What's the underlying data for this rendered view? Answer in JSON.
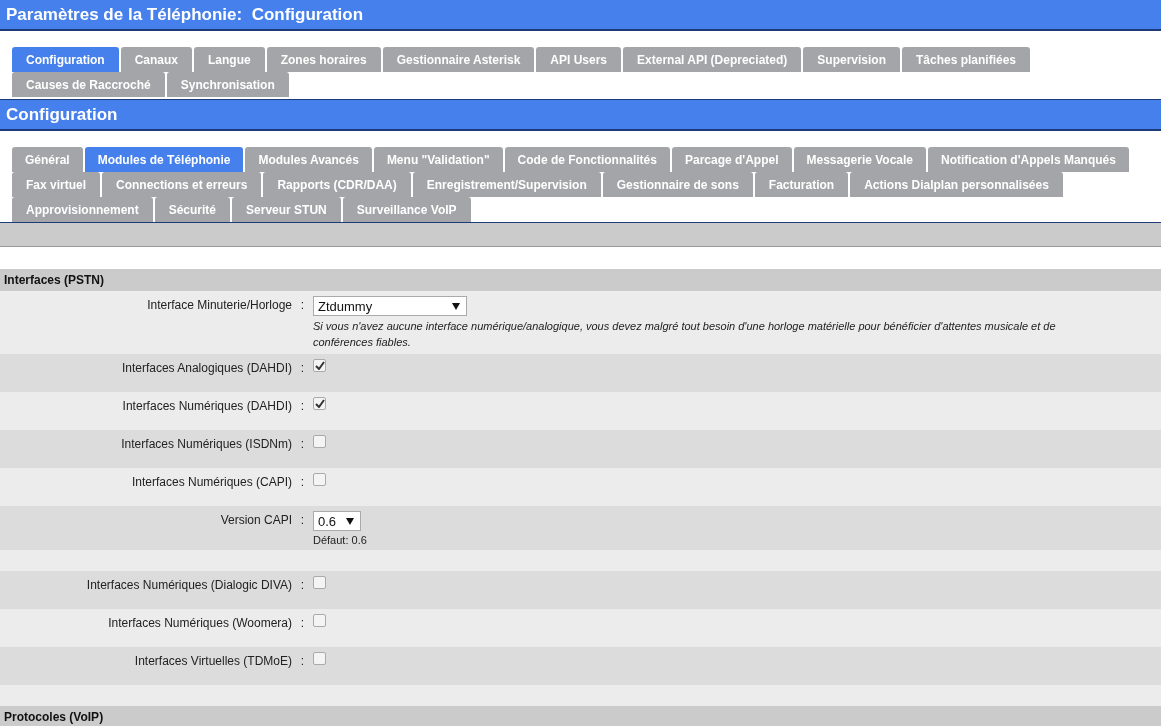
{
  "page_title": {
    "label": "Paramètres de la Téléphonie:",
    "value": "Configuration"
  },
  "main_tab_rows": [
    [
      {
        "label": "Configuration",
        "selected": true
      },
      {
        "label": "Canaux",
        "selected": false
      },
      {
        "label": "Langue",
        "selected": false
      },
      {
        "label": "Zones horaires",
        "selected": false
      },
      {
        "label": "Gestionnaire Asterisk",
        "selected": false
      },
      {
        "label": "API Users",
        "selected": false
      },
      {
        "label": "External API (Depreciated)",
        "selected": false
      },
      {
        "label": "Supervision",
        "selected": false
      },
      {
        "label": "Tâches planifiées",
        "selected": false
      }
    ],
    [
      {
        "label": "Causes de Raccroché",
        "selected": false
      },
      {
        "label": "Synchronisation",
        "selected": false
      }
    ]
  ],
  "section_title": "Configuration",
  "sub_tab_rows": [
    [
      {
        "label": "Général",
        "selected": false
      },
      {
        "label": "Modules de Téléphonie",
        "selected": true
      },
      {
        "label": "Modules Avancés",
        "selected": false
      },
      {
        "label": "Menu \"Validation\"",
        "selected": false
      },
      {
        "label": "Code de Fonctionnalités",
        "selected": false
      },
      {
        "label": "Parcage d'Appel",
        "selected": false
      },
      {
        "label": "Messagerie Vocale",
        "selected": false
      },
      {
        "label": "Notification d'Appels Manqués",
        "selected": false
      }
    ],
    [
      {
        "label": "Fax virtuel",
        "selected": false
      },
      {
        "label": "Connections et erreurs",
        "selected": false
      },
      {
        "label": "Rapports (CDR/DAA)",
        "selected": false
      },
      {
        "label": "Enregistrement/Supervision",
        "selected": false
      },
      {
        "label": "Gestionnaire de sons",
        "selected": false
      },
      {
        "label": "Facturation",
        "selected": false
      },
      {
        "label": "Actions Dialplan personnalisées",
        "selected": false
      }
    ],
    [
      {
        "label": "Approvisionnement",
        "selected": false
      },
      {
        "label": "Sécurité",
        "selected": false
      },
      {
        "label": "Serveur STUN",
        "selected": false
      },
      {
        "label": "Surveillance VoIP",
        "selected": false
      }
    ]
  ],
  "form_rows": [
    {
      "kind": "heading",
      "label": "Interfaces (PSTN)"
    },
    {
      "kind": "select",
      "label": "Interface Minuterie/Horloge",
      "separator": ":",
      "value": "Ztdummy",
      "wide": true,
      "help": "Si vous n'avez aucune interface numérique/analogique, vous devez malgré tout besoin d'une horloge matérielle pour bénéficier d'attentes musicale et de conférences fiables."
    },
    {
      "kind": "checkbox",
      "label": "Interfaces Analogiques (DAHDI)",
      "separator": ":",
      "checked": true
    },
    {
      "kind": "checkbox",
      "label": "Interfaces Numériques (DAHDI)",
      "separator": ":",
      "checked": true
    },
    {
      "kind": "checkbox",
      "label": "Interfaces Numériques (ISDNm)",
      "separator": ":",
      "checked": false
    },
    {
      "kind": "checkbox",
      "label": "Interfaces Numériques (CAPI)",
      "separator": ":",
      "checked": false
    },
    {
      "kind": "select",
      "label": "Version CAPI",
      "separator": ":",
      "value": "0.6",
      "wide": false,
      "default": "Défaut: 0.6"
    },
    {
      "kind": "spacer"
    },
    {
      "kind": "checkbox",
      "label": "Interfaces Numériques (Dialogic DIVA)",
      "separator": ":",
      "checked": false
    },
    {
      "kind": "checkbox",
      "label": "Interfaces Numériques (Woomera)",
      "separator": ":",
      "checked": false
    },
    {
      "kind": "checkbox",
      "label": "Interfaces Virtuelles (TDMoE)",
      "separator": ":",
      "checked": false
    },
    {
      "kind": "spacer"
    },
    {
      "kind": "heading",
      "label": "Protocoles (VoIP)"
    }
  ]
}
